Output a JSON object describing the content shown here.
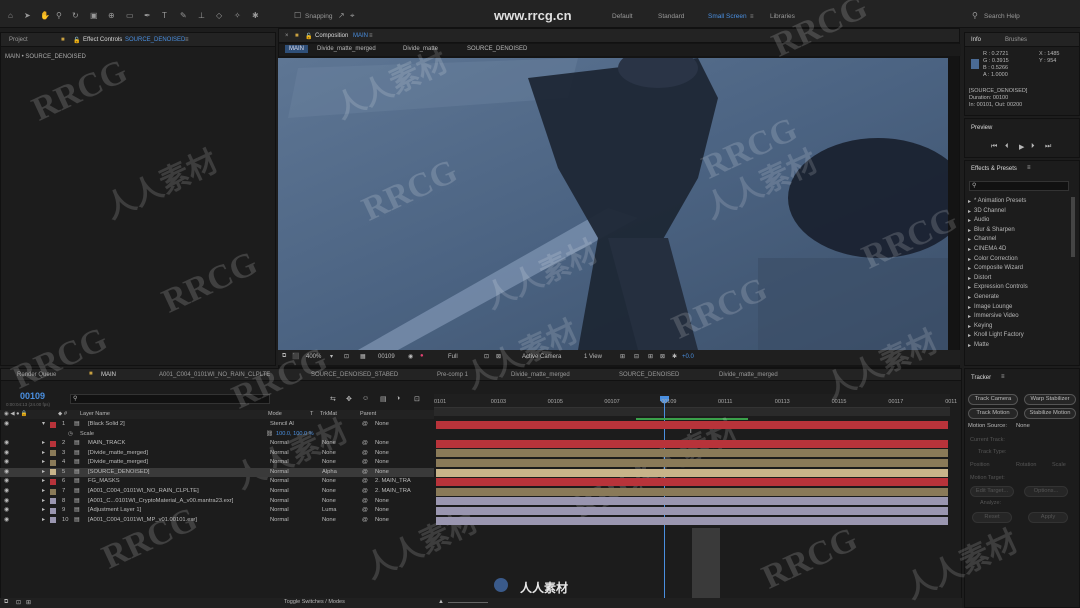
{
  "topbar": {
    "snapping": "Snapping",
    "workspaces": [
      "Default",
      "Standard",
      "Small Screen",
      "Libraries"
    ],
    "active_workspace": "Small Screen",
    "search": "Search Help",
    "watermark_url": "www.rrcg.cn"
  },
  "project_panel": {
    "tabs": [
      "Project",
      "Effect Controls"
    ],
    "effect_controls_target": "SOURCE_DENOISED",
    "breadcrumb": "MAIN • SOURCE_DENOISED"
  },
  "composition_panel": {
    "tab_label": "Composition",
    "comp_name": "MAIN",
    "breadcrumbs": [
      "MAIN",
      "Divide_matte_merged",
      "Divide_matte",
      "SOURCE_DENOISED"
    ]
  },
  "viewer_toolbar": {
    "zoom": "400%",
    "timecode": "00109",
    "resolution": "Full",
    "camera": "Active Camera",
    "view": "1 View",
    "exposure": "+0.0"
  },
  "info_panel": {
    "tabs": [
      "Info",
      "Brushes"
    ],
    "r": "R : 0.2721",
    "g": "G : 0.3915",
    "b": "B : 0.5266",
    "a": "A : 1.0000",
    "x": "X : 1485",
    "y": "Y : 954",
    "layer": "[SOURCE_DENOISED]",
    "duration": "Duration: 00100",
    "in_out": "In: 00101, Out: 00200"
  },
  "preview_panel": {
    "title": "Preview"
  },
  "effects_panel": {
    "title": "Effects & Presets",
    "items": [
      "* Animation Presets",
      "3D Channel",
      "Audio",
      "Blur & Sharpen",
      "Channel",
      "CINEMA 4D",
      "Color Correction",
      "Composite Wizard",
      "Distort",
      "Expression Controls",
      "Generate",
      "Image Lounge",
      "Immersive Video",
      "Keying",
      "Knoll Light Factory",
      "Matte"
    ]
  },
  "tracker_panel": {
    "title": "Tracker",
    "buttons": [
      "Track Camera",
      "Warp Stabilizer",
      "Track Motion",
      "Stabilize Motion"
    ],
    "motion_source_label": "Motion Source:",
    "motion_source": "None",
    "current_track": "Current Track:",
    "track_type": "Track Type:",
    "position": "Position",
    "rotation": "Rotation",
    "scale": "Scale",
    "motion_target": "Motion Target:",
    "edit_target": "Edit Target...",
    "options": "Options...",
    "analyze": "Analyze:",
    "reset": "Reset",
    "apply": "Apply"
  },
  "timeline": {
    "tabs": [
      "Render Queue",
      "MAIN",
      "A001_C004_0101WI_NO_RAIN_CLPLTE",
      "SOURCE_DENOISED_STABED",
      "Pre-comp 1",
      "Divide_matte_merged",
      "SOURCE_DENOISED",
      "Divide_matte_merged"
    ],
    "current_time": "00109",
    "current_time_sub": "0:00:04:13 (24.00 fps)",
    "headers": {
      "num": "#",
      "name": "Layer Name",
      "mode": "Mode",
      "t": "T",
      "trkmat": "TrkMat",
      "parent": "Parent"
    },
    "ruler": [
      "0101",
      "00103",
      "00105",
      "00107",
      "00109",
      "00111",
      "00113",
      "00115",
      "00117",
      "0011"
    ],
    "scale_label": "Scale",
    "scale_value": "100.0, 100.0 %",
    "layers": [
      {
        "num": "1",
        "name": "[Black Solid 2]",
        "mode": "Stencil Al",
        "trk": "",
        "parent": "None",
        "color": "#b8333a"
      },
      {
        "num": "2",
        "name": "MAIN_TRACK",
        "mode": "Normal",
        "trk": "None",
        "parent": "None",
        "color": "#b8333a"
      },
      {
        "num": "3",
        "name": "[Divide_matte_merged]",
        "mode": "Normal",
        "trk": "None",
        "parent": "None",
        "color": "#8a7a58"
      },
      {
        "num": "4",
        "name": "[Divide_matte_merged]",
        "mode": "Normal",
        "trk": "None",
        "parent": "None",
        "color": "#8a7a58"
      },
      {
        "num": "5",
        "name": "[SOURCE_DENOISED]",
        "mode": "Normal",
        "trk": "Alpha",
        "parent": "None",
        "color": "#c8b48a"
      },
      {
        "num": "6",
        "name": "FG_MASKS",
        "mode": "Normal",
        "trk": "None",
        "parent": "2. MAIN_TRA",
        "color": "#b8333a"
      },
      {
        "num": "7",
        "name": "[A001_C004_0101WI_NO_RAIN_CLPLTE]",
        "mode": "Normal",
        "trk": "None",
        "parent": "2. MAIN_TRA",
        "color": "#8a7a58"
      },
      {
        "num": "8",
        "name": "[A001_C...0101WI_CryptoMaterial_A_v00.mantra23.exr]",
        "mode": "Normal",
        "trk": "None",
        "parent": "None",
        "color": "#9a96b0"
      },
      {
        "num": "9",
        "name": "[Adjustment Layer 1]",
        "mode": "Normal",
        "trk": "Luma",
        "parent": "None",
        "color": "#9a96b0"
      },
      {
        "num": "10",
        "name": "[A001_C004_0101WI_MP_v01.00101.exr]",
        "mode": "Normal",
        "trk": "None",
        "parent": "None",
        "color": "#9a96b0"
      }
    ],
    "toggle_label": "Toggle Switches / Modes"
  },
  "watermarks": {
    "latin": "RRCG",
    "cjk": "人人素材"
  }
}
